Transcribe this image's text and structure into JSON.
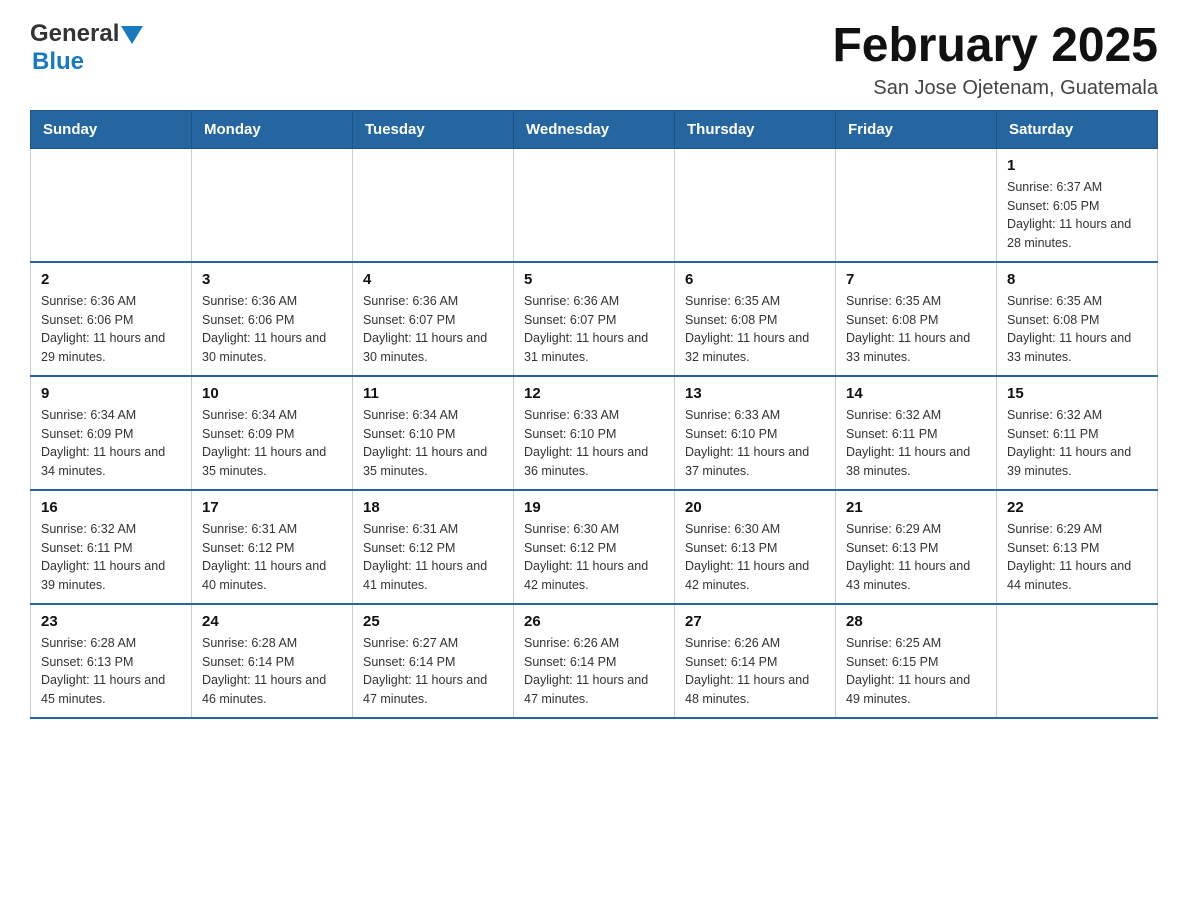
{
  "header": {
    "logo": {
      "general": "General",
      "blue": "Blue"
    },
    "title": "February 2025",
    "subtitle": "San Jose Ojetenam, Guatemala"
  },
  "calendar": {
    "days_of_week": [
      "Sunday",
      "Monday",
      "Tuesday",
      "Wednesday",
      "Thursday",
      "Friday",
      "Saturday"
    ],
    "weeks": [
      [
        {
          "day": "",
          "info": ""
        },
        {
          "day": "",
          "info": ""
        },
        {
          "day": "",
          "info": ""
        },
        {
          "day": "",
          "info": ""
        },
        {
          "day": "",
          "info": ""
        },
        {
          "day": "",
          "info": ""
        },
        {
          "day": "1",
          "info": "Sunrise: 6:37 AM\nSunset: 6:05 PM\nDaylight: 11 hours and 28 minutes."
        }
      ],
      [
        {
          "day": "2",
          "info": "Sunrise: 6:36 AM\nSunset: 6:06 PM\nDaylight: 11 hours and 29 minutes."
        },
        {
          "day": "3",
          "info": "Sunrise: 6:36 AM\nSunset: 6:06 PM\nDaylight: 11 hours and 30 minutes."
        },
        {
          "day": "4",
          "info": "Sunrise: 6:36 AM\nSunset: 6:07 PM\nDaylight: 11 hours and 30 minutes."
        },
        {
          "day": "5",
          "info": "Sunrise: 6:36 AM\nSunset: 6:07 PM\nDaylight: 11 hours and 31 minutes."
        },
        {
          "day": "6",
          "info": "Sunrise: 6:35 AM\nSunset: 6:08 PM\nDaylight: 11 hours and 32 minutes."
        },
        {
          "day": "7",
          "info": "Sunrise: 6:35 AM\nSunset: 6:08 PM\nDaylight: 11 hours and 33 minutes."
        },
        {
          "day": "8",
          "info": "Sunrise: 6:35 AM\nSunset: 6:08 PM\nDaylight: 11 hours and 33 minutes."
        }
      ],
      [
        {
          "day": "9",
          "info": "Sunrise: 6:34 AM\nSunset: 6:09 PM\nDaylight: 11 hours and 34 minutes."
        },
        {
          "day": "10",
          "info": "Sunrise: 6:34 AM\nSunset: 6:09 PM\nDaylight: 11 hours and 35 minutes."
        },
        {
          "day": "11",
          "info": "Sunrise: 6:34 AM\nSunset: 6:10 PM\nDaylight: 11 hours and 35 minutes."
        },
        {
          "day": "12",
          "info": "Sunrise: 6:33 AM\nSunset: 6:10 PM\nDaylight: 11 hours and 36 minutes."
        },
        {
          "day": "13",
          "info": "Sunrise: 6:33 AM\nSunset: 6:10 PM\nDaylight: 11 hours and 37 minutes."
        },
        {
          "day": "14",
          "info": "Sunrise: 6:32 AM\nSunset: 6:11 PM\nDaylight: 11 hours and 38 minutes."
        },
        {
          "day": "15",
          "info": "Sunrise: 6:32 AM\nSunset: 6:11 PM\nDaylight: 11 hours and 39 minutes."
        }
      ],
      [
        {
          "day": "16",
          "info": "Sunrise: 6:32 AM\nSunset: 6:11 PM\nDaylight: 11 hours and 39 minutes."
        },
        {
          "day": "17",
          "info": "Sunrise: 6:31 AM\nSunset: 6:12 PM\nDaylight: 11 hours and 40 minutes."
        },
        {
          "day": "18",
          "info": "Sunrise: 6:31 AM\nSunset: 6:12 PM\nDaylight: 11 hours and 41 minutes."
        },
        {
          "day": "19",
          "info": "Sunrise: 6:30 AM\nSunset: 6:12 PM\nDaylight: 11 hours and 42 minutes."
        },
        {
          "day": "20",
          "info": "Sunrise: 6:30 AM\nSunset: 6:13 PM\nDaylight: 11 hours and 42 minutes."
        },
        {
          "day": "21",
          "info": "Sunrise: 6:29 AM\nSunset: 6:13 PM\nDaylight: 11 hours and 43 minutes."
        },
        {
          "day": "22",
          "info": "Sunrise: 6:29 AM\nSunset: 6:13 PM\nDaylight: 11 hours and 44 minutes."
        }
      ],
      [
        {
          "day": "23",
          "info": "Sunrise: 6:28 AM\nSunset: 6:13 PM\nDaylight: 11 hours and 45 minutes."
        },
        {
          "day": "24",
          "info": "Sunrise: 6:28 AM\nSunset: 6:14 PM\nDaylight: 11 hours and 46 minutes."
        },
        {
          "day": "25",
          "info": "Sunrise: 6:27 AM\nSunset: 6:14 PM\nDaylight: 11 hours and 47 minutes."
        },
        {
          "day": "26",
          "info": "Sunrise: 6:26 AM\nSunset: 6:14 PM\nDaylight: 11 hours and 47 minutes."
        },
        {
          "day": "27",
          "info": "Sunrise: 6:26 AM\nSunset: 6:14 PM\nDaylight: 11 hours and 48 minutes."
        },
        {
          "day": "28",
          "info": "Sunrise: 6:25 AM\nSunset: 6:15 PM\nDaylight: 11 hours and 49 minutes."
        },
        {
          "day": "",
          "info": ""
        }
      ]
    ]
  }
}
